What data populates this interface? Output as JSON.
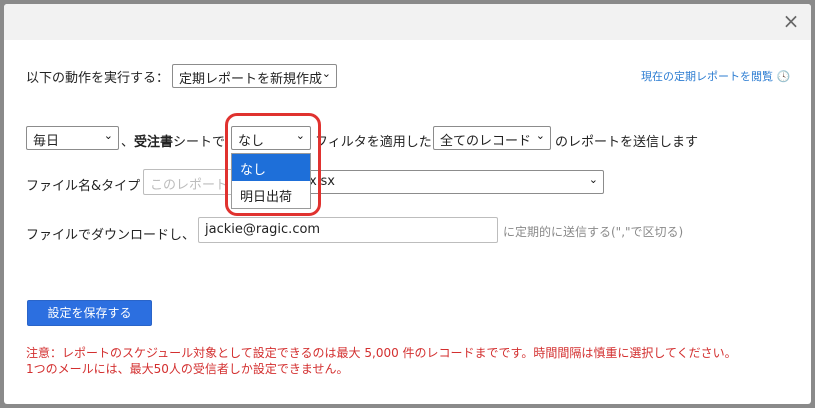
{
  "dialog": {
    "close_label": "×"
  },
  "action": {
    "label": "以下の動作を実行する：",
    "selected": "定期レポートを新規作成",
    "view_link": "現在の定期レポートを閲覧"
  },
  "schedule": {
    "frequency": "毎日",
    "connector": "、",
    "sheet_name": "受注書",
    "sheet_suffix": "シートで",
    "filter_selected": "なし",
    "filter_options": [
      "なし",
      "明日出荷"
    ],
    "filter_suffix": "フィルタを適用した",
    "records_selected": "全てのレコード",
    "send_suffix": "のレポートを送信します"
  },
  "filename": {
    "label": "ファイル名&タイプ",
    "placeholder": "このレポート",
    "type_selected": ".xlsx"
  },
  "download": {
    "label": "ファイルでダウンロードし、",
    "email_value": "jackie@ragic.com",
    "hint": "に定期的に送信する(\",\"で区切る)"
  },
  "save_button": "設定を保存する",
  "notes": [
    "注意：レポートのスケジュール対象として設定できるのは最大 5,000 件のレコードまでです。時間間隔は慎重に選択してください。",
    "1つのメールには、最大50人の受信者しか設定できません。"
  ],
  "colors": {
    "accent": "#2c6fe0",
    "warning": "#d32f2f",
    "highlight": "#e0322f",
    "link": "#2d7dd2"
  }
}
